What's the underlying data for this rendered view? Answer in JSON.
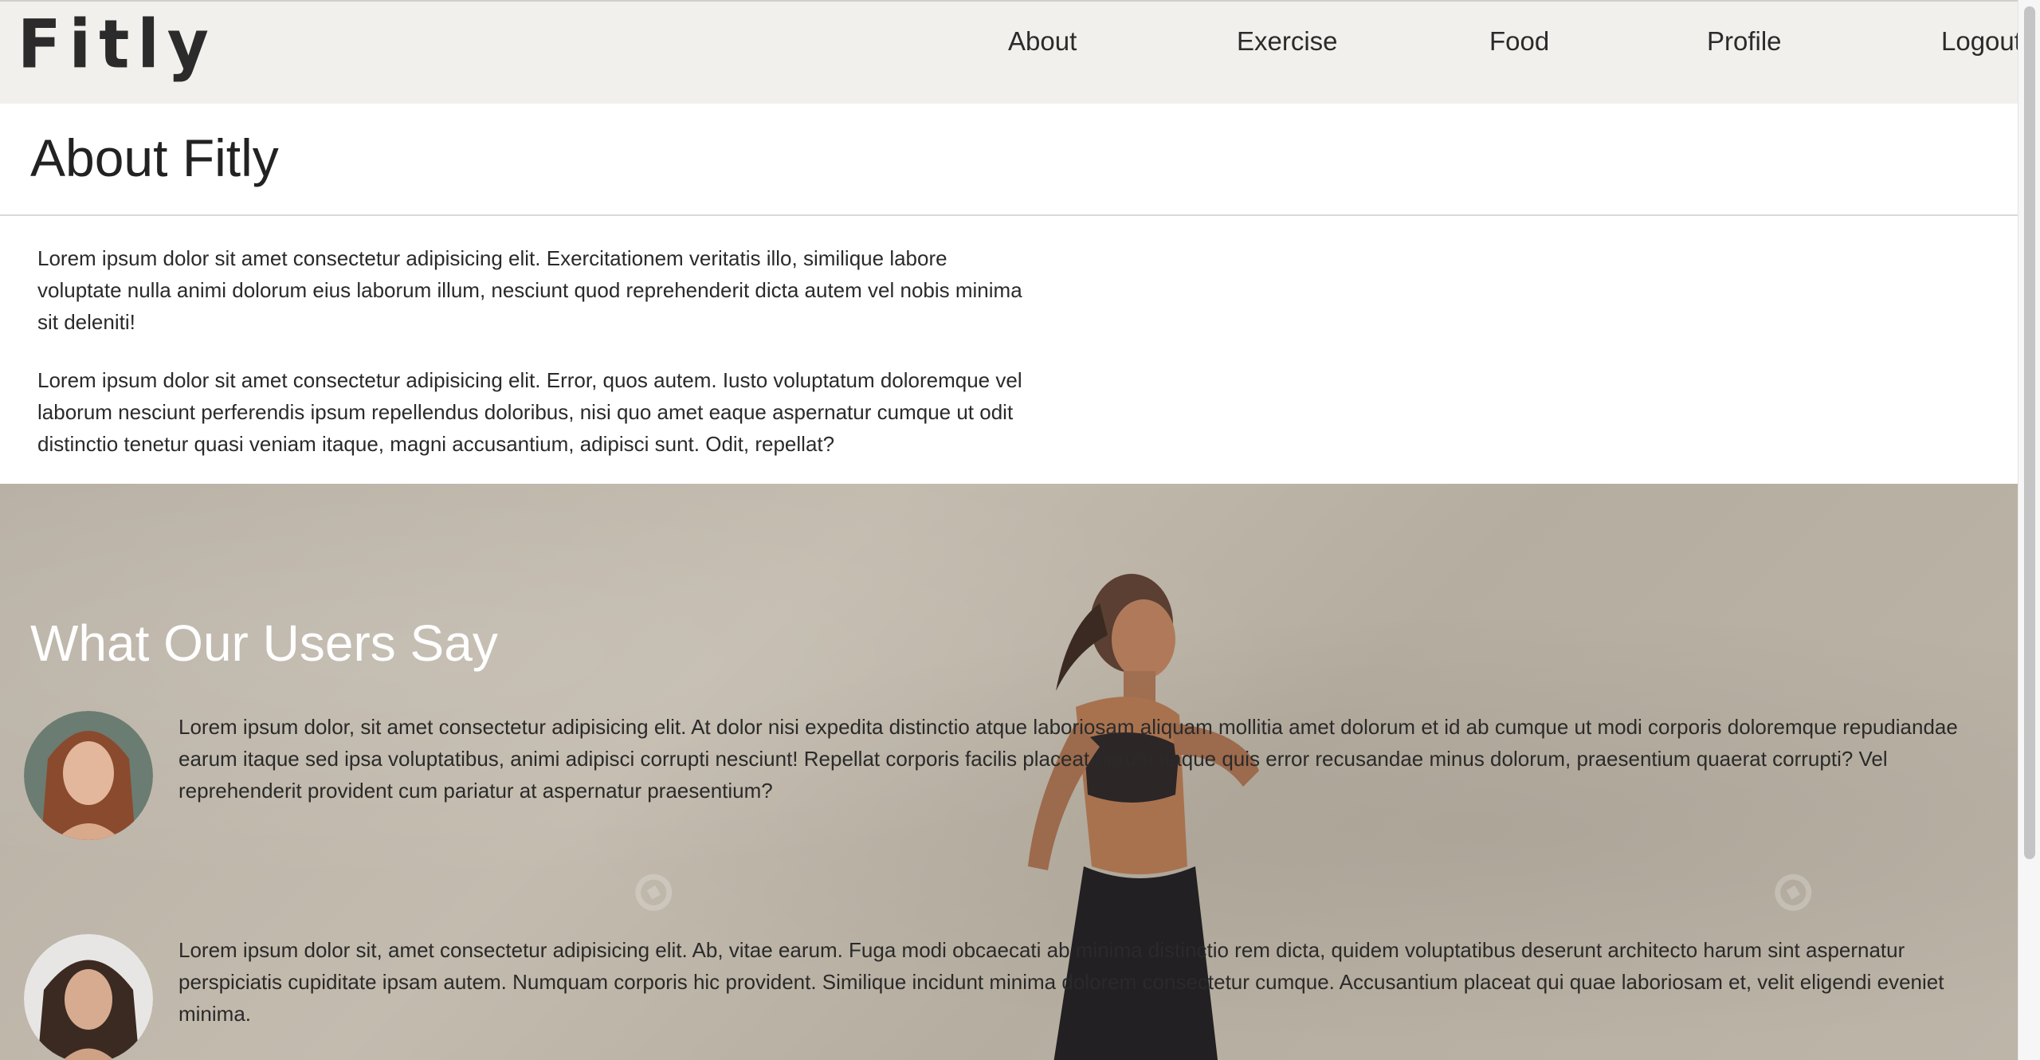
{
  "nav": {
    "logo": "Fitly",
    "links": [
      "About",
      "Exercise",
      "Food",
      "Profile",
      "Logout"
    ]
  },
  "about": {
    "title": "About Fitly",
    "paragraphs": [
      "Lorem ipsum dolor sit amet consectetur adipisicing elit. Exercitationem veritatis illo, similique labore voluptate nulla animi dolorum eius laborum illum, nesciunt quod reprehenderit dicta autem vel nobis minima sit deleniti!",
      "Lorem ipsum dolor sit amet consectetur adipisicing elit. Error, quos autem. Iusto voluptatum doloremque vel laborum nesciunt perferendis ipsum repellendus doloribus, nisi quo amet eaque aspernatur cumque ut odit distinctio tenetur quasi veniam itaque, magni accusantium, adipisci sunt. Odit, repellat?"
    ]
  },
  "testimonials": {
    "title": "What Our Users Say",
    "items": [
      "Lorem ipsum dolor, sit amet consectetur adipisicing elit. At dolor nisi expedita distinctio atque laboriosam aliquam mollitia amet dolorum et id ab cumque ut modi corporis doloremque repudiandae earum itaque sed ipsa voluptatibus, animi adipisci corrupti nesciunt! Repellat corporis facilis placeat harum itaque quis error recusandae minus dolorum, praesentium quaerat corrupti? Vel reprehenderit provident cum pariatur at aspernatur praesentium?",
      "Lorem ipsum dolor sit, amet consectetur adipisicing elit. Ab, vitae earum. Fuga modi obcaecati ab minima distinctio rem dicta, quidem voluptatibus deserunt architecto harum sint aspernatur perspiciatis cupiditate ipsam autem. Numquam corporis hic provident. Similique incidunt minima dolorem consectetur cumque. Accusantium placeat qui quae laboriosam et, velit eligendi eveniet minima."
    ]
  }
}
